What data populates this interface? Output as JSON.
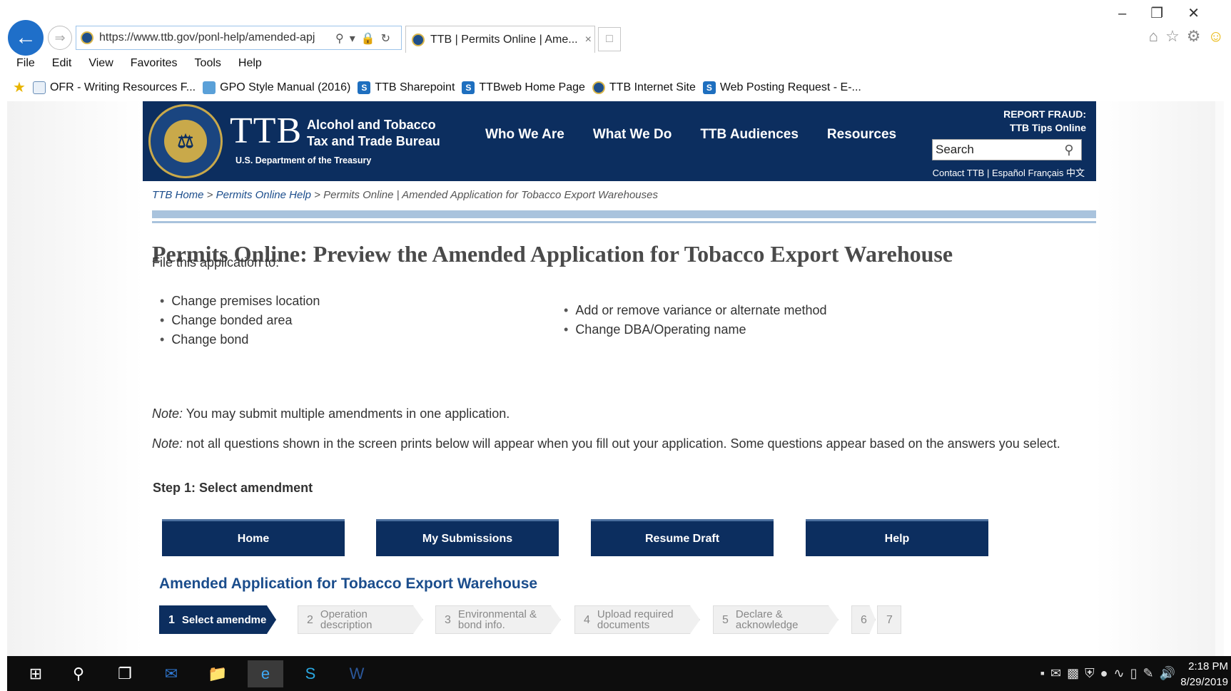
{
  "browser": {
    "address": "https://www.ttb.gov/ponl-help/amended-apj",
    "tab_title": "TTB | Permits Online | Ame...",
    "tab_close": "×",
    "menu": [
      "File",
      "Edit",
      "View",
      "Favorites",
      "Tools",
      "Help"
    ],
    "favorites": [
      {
        "label": "OFR - Writing Resources F...",
        "icon": "doc"
      },
      {
        "label": "GPO Style Manual (2016)",
        "icon": "gpo"
      },
      {
        "label": "TTB Sharepoint",
        "icon": "sharepoint"
      },
      {
        "label": "TTBweb Home Page",
        "icon": "sharepoint"
      },
      {
        "label": "TTB Internet Site",
        "icon": "seal"
      },
      {
        "label": "Web Posting Request - E-...",
        "icon": "sharepoint"
      }
    ]
  },
  "header": {
    "logo_text": "TTB",
    "agency_line1": "Alcohol and Tobacco",
    "agency_line2": "Tax and Trade Bureau",
    "department": "U.S. Department of the Treasury",
    "nav": [
      "Who We Are",
      "What We Do",
      "TTB Audiences",
      "Resources"
    ],
    "fraud_line1": "REPORT FRAUD:",
    "fraud_line2": "TTB Tips Online",
    "search_placeholder": "Search",
    "links": "Contact TTB  |  Español  Français  中文"
  },
  "breadcrumb": {
    "home": "TTB Home",
    "sep": " > ",
    "help": "Permits Online Help",
    "current": "Permits Online | Amended Application for Tobacco Export Warehouses"
  },
  "content": {
    "title": "Permits Online: Preview the Amended Application for Tobacco Export Warehouse",
    "intro": "File this application to:",
    "bullets_left": [
      "Change premises location",
      "Change bonded area",
      "Change bond"
    ],
    "bullets_right": [
      "Add or remove variance or alternate method",
      "Change DBA/Operating name"
    ],
    "note_label": "Note:",
    "note1": " You may submit multiple amendments in one application.",
    "note2": " not all questions shown in the screen prints below will appear when you fill out your application.  Some questions appear based on the answers you select.",
    "step_heading": "Step 1: Select amendment"
  },
  "app": {
    "buttons": [
      "Home",
      "My Submissions",
      "Resume Draft",
      "Help"
    ],
    "heading": "Amended Application for Tobacco Export Warehouse",
    "steps": [
      {
        "num": "1",
        "label": "Select amendme",
        "active": true
      },
      {
        "num": "2",
        "label": "Operation\ndescription",
        "active": false
      },
      {
        "num": "3",
        "label": "Environmental &\nbond info.",
        "active": false
      },
      {
        "num": "4",
        "label": "Upload required\ndocuments",
        "active": false
      },
      {
        "num": "5",
        "label": "Declare &\nacknowledge",
        "active": false
      },
      {
        "num": "6",
        "label": "",
        "active": false
      },
      {
        "num": "7",
        "label": "",
        "active": false
      }
    ]
  },
  "taskbar": {
    "time": "2:18 PM",
    "date": "8/29/2019"
  }
}
